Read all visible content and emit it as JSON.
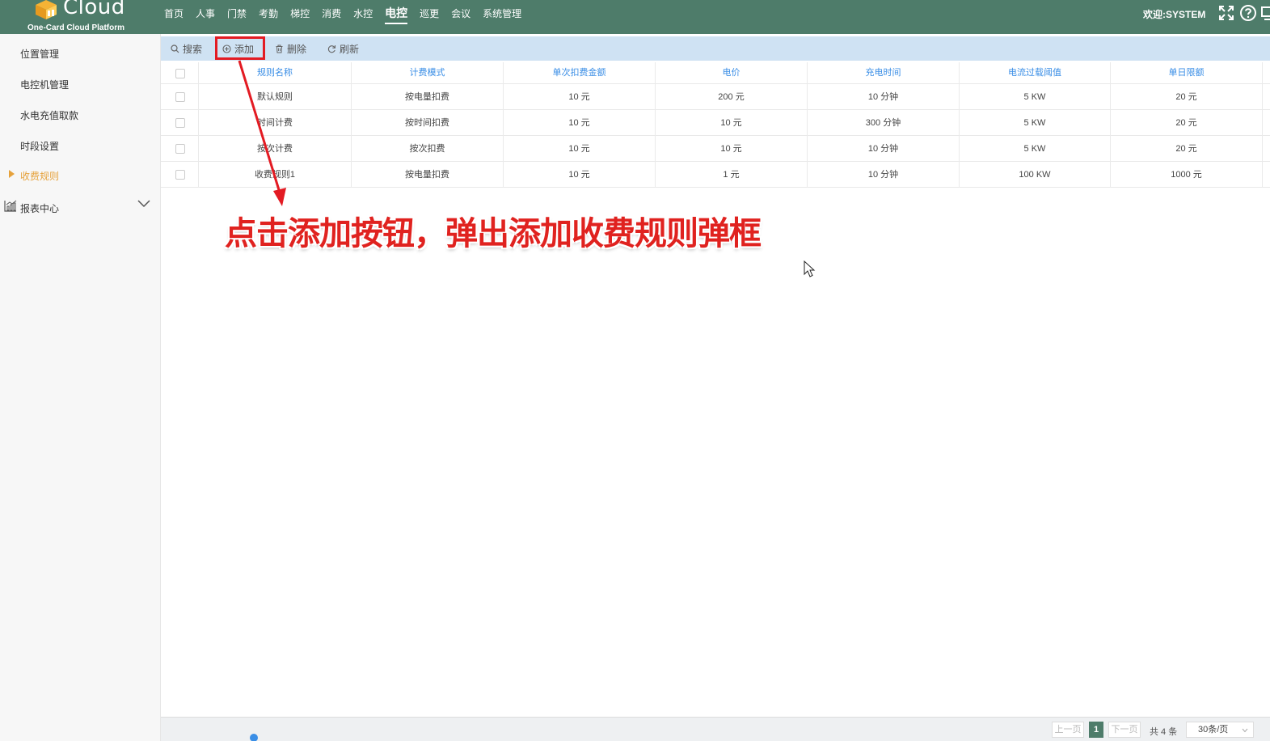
{
  "header": {
    "logo_text": "Cloud",
    "logo_subtitle": "One-Card Cloud Platform",
    "nav": [
      "首页",
      "人事",
      "门禁",
      "考勤",
      "梯控",
      "消费",
      "水控",
      "电控",
      "巡更",
      "会议",
      "系统管理"
    ],
    "active_nav": "电控",
    "welcome": "欢迎:SYSTEM",
    "icons": [
      "fullscreen-icon",
      "help-icon",
      "screen-icon"
    ]
  },
  "sidebar": {
    "items": [
      {
        "label": "位置管理",
        "active": false
      },
      {
        "label": "电控机管理",
        "active": false
      },
      {
        "label": "水电充值取款",
        "active": false
      },
      {
        "label": "时段设置",
        "active": false
      },
      {
        "label": "收费规则",
        "active": true
      }
    ],
    "report": {
      "label": "报表中心",
      "icon": "chart-icon",
      "expand_icon": "chevron-down-icon"
    }
  },
  "toolbar": {
    "search": "搜索",
    "add": "添加",
    "delete": "删除",
    "refresh": "刷新"
  },
  "table": {
    "columns": [
      "规则名称",
      "计费模式",
      "单次扣费金额",
      "电价",
      "充电时间",
      "电流过载阈值",
      "单日限额"
    ],
    "rows": [
      [
        "默认规则",
        "按电量扣费",
        "10 元",
        "200 元",
        "10 分钟",
        "5 KW",
        "20 元"
      ],
      [
        "时间计费",
        "按时间扣费",
        "10 元",
        "10 元",
        "300 分钟",
        "5 KW",
        "20 元"
      ],
      [
        "按次计费",
        "按次扣费",
        "10 元",
        "10 元",
        "10 分钟",
        "5 KW",
        "20 元"
      ],
      [
        "收费规则1",
        "按电量扣费",
        "10 元",
        "1 元",
        "10 分钟",
        "100 KW",
        "1000 元"
      ]
    ]
  },
  "annotation": {
    "text": "点击添加按钮，弹出添加收费规则弹框",
    "color": "#e0221f"
  },
  "pagination": {
    "prev": "上一页",
    "current": "1",
    "next": "下一页",
    "total": "共 4 条",
    "page_size": "30条/页"
  },
  "colors": {
    "header_bg": "#4e7c6a",
    "toolbar_bg": "#cfe2f3",
    "accent_active": "#e6a23c",
    "column_header_text": "#3a8ee6",
    "highlight_red": "#e31b23"
  }
}
